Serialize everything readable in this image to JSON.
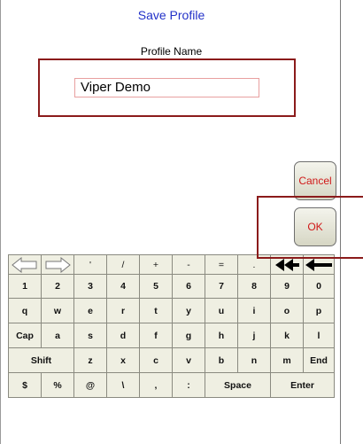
{
  "screen": {
    "title": "Save Profile",
    "field_label": "Profile Name",
    "field_value": "Viper Demo",
    "cancel_label": "Cancel",
    "ok_label": "OK"
  },
  "keyboard": {
    "row1": [
      "left-outline-arrow-icon",
      "right-outline-arrow-icon",
      "'",
      "/",
      "+",
      "-",
      "=",
      ".",
      "double-left-arrow-icon",
      "backspace-arrow-icon"
    ],
    "row2": [
      "1",
      "2",
      "3",
      "4",
      "5",
      "6",
      "7",
      "8",
      "9",
      "0"
    ],
    "row3": [
      "q",
      "w",
      "e",
      "r",
      "t",
      "y",
      "u",
      "i",
      "o",
      "p"
    ],
    "row4": [
      "Cap",
      "a",
      "s",
      "d",
      "f",
      "g",
      "h",
      "j",
      "k",
      "l"
    ],
    "row5": [
      "Shift",
      "z",
      "x",
      "c",
      "v",
      "b",
      "n",
      "m",
      "End"
    ],
    "row6": [
      "$",
      "%",
      "@",
      "\\",
      ",",
      ":",
      "Space",
      "Enter"
    ]
  },
  "colors": {
    "title": "#2231c8",
    "callout": "#8b1b1b",
    "button_text": "#d01818",
    "key_bg": "#efefe2"
  }
}
